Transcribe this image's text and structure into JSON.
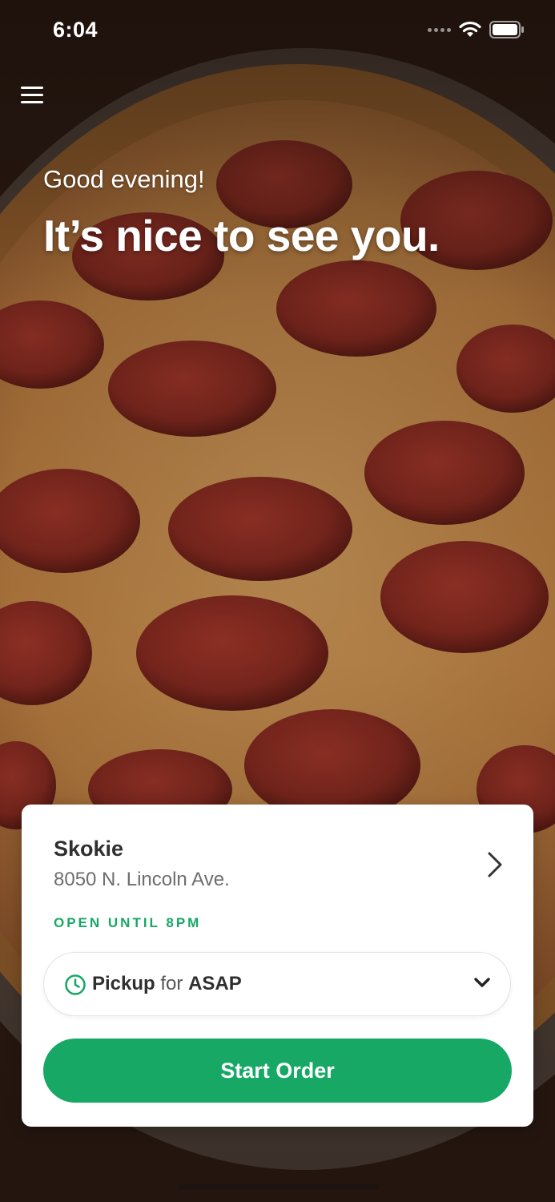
{
  "status_bar": {
    "time": "6:04"
  },
  "icons": {
    "menu": "hamburger-menu-icon",
    "wifi": "wifi-icon",
    "battery": "battery-icon",
    "clock": "clock-icon",
    "chevron_right": "chevron-right-icon",
    "chevron_down": "chevron-down-icon"
  },
  "hero": {
    "greeting": "Good evening!",
    "headline": "It’s nice to see you."
  },
  "location": {
    "name": "Skokie",
    "address": "8050 N. Lincoln Ave.",
    "hours": "OPEN UNTIL 8PM"
  },
  "order_type": {
    "mode": "Pickup",
    "connector": "for",
    "time": "ASAP"
  },
  "actions": {
    "start_order": "Start Order"
  },
  "colors": {
    "accent": "#17a866",
    "card_bg": "#ffffff",
    "text_dark": "#2f2f2f",
    "text_muted": "#6d6d6d"
  }
}
